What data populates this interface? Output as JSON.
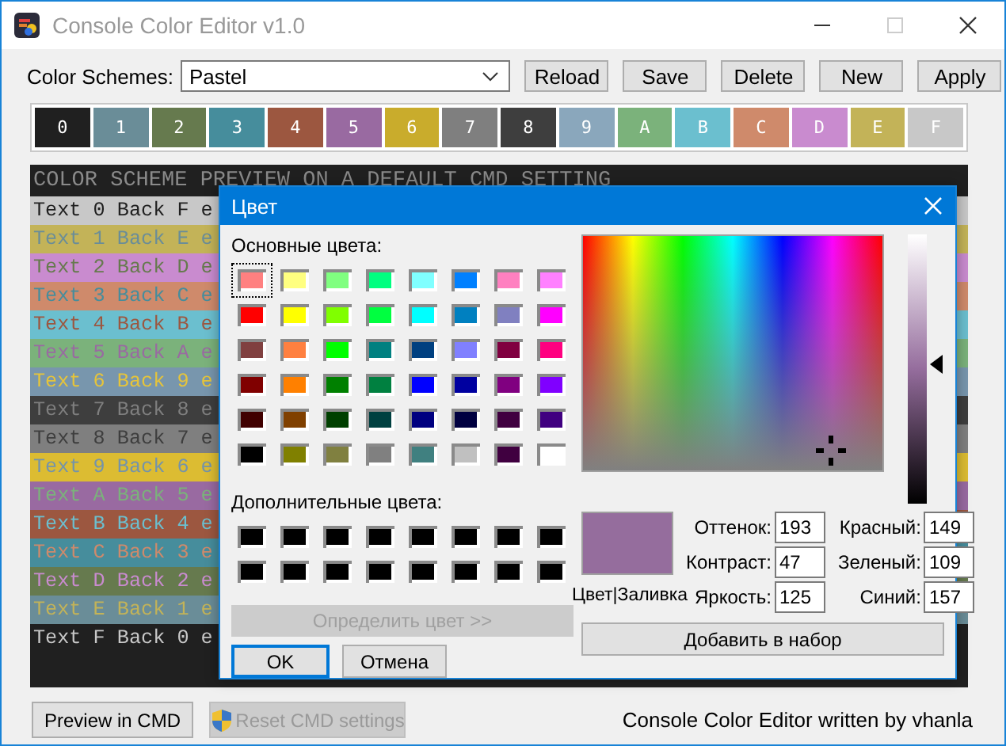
{
  "window": {
    "title": "Console Color Editor v1.0"
  },
  "toolbar": {
    "label": "Color Schemes:",
    "scheme": "Pastel",
    "buttons": [
      "Reload",
      "Save",
      "Delete",
      "New",
      "Apply"
    ]
  },
  "palette": [
    {
      "label": "0",
      "color": "#202020"
    },
    {
      "label": "1",
      "color": "#6a8d98"
    },
    {
      "label": "2",
      "color": "#667a4e"
    },
    {
      "label": "3",
      "color": "#468d9c"
    },
    {
      "label": "4",
      "color": "#9c5740"
    },
    {
      "label": "5",
      "color": "#996aa1"
    },
    {
      "label": "6",
      "color": "#c9ac2c"
    },
    {
      "label": "7",
      "color": "#7f7f7f"
    },
    {
      "label": "8",
      "color": "#3e3e3e"
    },
    {
      "label": "9",
      "color": "#8aa7bc"
    },
    {
      "label": "A",
      "color": "#7bb27b"
    },
    {
      "label": "B",
      "color": "#6bbfcf"
    },
    {
      "label": "C",
      "color": "#cf8a6b"
    },
    {
      "label": "D",
      "color": "#c98bcf"
    },
    {
      "label": "E",
      "color": "#c3b358"
    },
    {
      "label": "F",
      "color": "#c8c8c8"
    }
  ],
  "preview": {
    "header": "COLOR SCHEME PREVIEW ON A DEFAULT CMD SETTING",
    "rows": [
      {
        "color": "#c8c8c8",
        "label": {
          "text": "Text 0 Back F e",
          "color": "#202020"
        }
      },
      {
        "color": "#c3b358",
        "label": {
          "text": "Text 1 Back E e",
          "color": "#6a8d98"
        }
      },
      {
        "color": "#c98bcf",
        "label": {
          "text": "Text 2 Back D e",
          "color": "#667a4e"
        }
      },
      {
        "color": "#cf8a6b",
        "label": {
          "text": "Text 3 Back C e",
          "color": "#468d9c"
        }
      },
      {
        "color": "#6bbfcf",
        "label": {
          "text": "Text 4 Back B e",
          "color": "#9c5740"
        }
      },
      {
        "color": "#7bb27b",
        "label": {
          "text": "Text 5 Back A e",
          "color": "#996aa1"
        }
      },
      {
        "color": "#7896ad",
        "label": {
          "text": "Text 6 Back 9 e",
          "color": "#e6c43a"
        }
      },
      {
        "color": "#3e3e3e",
        "label": {
          "text": "Text 7 Back 8 e",
          "color": "#7f7f7f"
        }
      },
      {
        "color": "#7f7f7f",
        "label": {
          "text": "Text 8 Back 7 e",
          "color": "#3e3e3e"
        }
      },
      {
        "color": "#dcbc32",
        "label": {
          "text": "Text 9 Back 6 e",
          "color": "#7393ab"
        }
      },
      {
        "color": "#996aa1",
        "label": {
          "text": "Text A Back 5 e",
          "color": "#7bb27b"
        }
      },
      {
        "color": "#9c5740",
        "label": {
          "text": "Text B Back 4 e",
          "color": "#6bbfcf"
        }
      },
      {
        "color": "#468d9c",
        "label": {
          "text": "Text C Back 3 e",
          "color": "#cf8a6b"
        }
      },
      {
        "color": "#667a4e",
        "label": {
          "text": "Text D Back 2 e",
          "color": "#c98bcf"
        }
      },
      {
        "color": "#6a8d98",
        "label": {
          "text": "Text E Back 1 e",
          "color": "#c3b358"
        }
      },
      {
        "color": "#202020",
        "label": {
          "text": "Text F Back 0 e",
          "color": "#c8c8c8"
        }
      }
    ]
  },
  "footer": {
    "buttons": [
      {
        "label": "Preview in CMD",
        "disabled": false,
        "kind": "plain"
      },
      {
        "label": "Reset CMD settings",
        "disabled": true,
        "kind": "shield"
      }
    ],
    "credit": "Console Color Editor written by vhanla"
  },
  "dialog": {
    "title": "Цвет",
    "basic_label": "Основные цвета:",
    "basic_colors": [
      {
        "color": "#ff8080",
        "selected": true
      },
      {
        "color": "#ffff80",
        "selected": false
      },
      {
        "color": "#80ff80",
        "selected": false
      },
      {
        "color": "#00ff80",
        "selected": false
      },
      {
        "color": "#80ffff",
        "selected": false
      },
      {
        "color": "#0080ff",
        "selected": false
      },
      {
        "color": "#ff80c0",
        "selected": false
      },
      {
        "color": "#ff80ff",
        "selected": false
      },
      {
        "color": "#ff0000",
        "selected": false
      },
      {
        "color": "#ffff00",
        "selected": false
      },
      {
        "color": "#80ff00",
        "selected": false
      },
      {
        "color": "#00ff40",
        "selected": false
      },
      {
        "color": "#00ffff",
        "selected": false
      },
      {
        "color": "#0080c0",
        "selected": false
      },
      {
        "color": "#8080c0",
        "selected": false
      },
      {
        "color": "#ff00ff",
        "selected": false
      },
      {
        "color": "#804040",
        "selected": false
      },
      {
        "color": "#ff8040",
        "selected": false
      },
      {
        "color": "#00ff00",
        "selected": false
      },
      {
        "color": "#008080",
        "selected": false
      },
      {
        "color": "#004080",
        "selected": false
      },
      {
        "color": "#8080ff",
        "selected": false
      },
      {
        "color": "#800040",
        "selected": false
      },
      {
        "color": "#ff0080",
        "selected": false
      },
      {
        "color": "#800000",
        "selected": false
      },
      {
        "color": "#ff8000",
        "selected": false
      },
      {
        "color": "#008000",
        "selected": false
      },
      {
        "color": "#008040",
        "selected": false
      },
      {
        "color": "#0000ff",
        "selected": false
      },
      {
        "color": "#0000a0",
        "selected": false
      },
      {
        "color": "#800080",
        "selected": false
      },
      {
        "color": "#8000ff",
        "selected": false
      },
      {
        "color": "#400000",
        "selected": false
      },
      {
        "color": "#804000",
        "selected": false
      },
      {
        "color": "#004000",
        "selected": false
      },
      {
        "color": "#004040",
        "selected": false
      },
      {
        "color": "#000080",
        "selected": false
      },
      {
        "color": "#000040",
        "selected": false
      },
      {
        "color": "#400040",
        "selected": false
      },
      {
        "color": "#400080",
        "selected": false
      },
      {
        "color": "#000000",
        "selected": false
      },
      {
        "color": "#808000",
        "selected": false
      },
      {
        "color": "#808040",
        "selected": false
      },
      {
        "color": "#808080",
        "selected": false
      },
      {
        "color": "#408080",
        "selected": false
      },
      {
        "color": "#c0c0c0",
        "selected": false
      },
      {
        "color": "#400040",
        "selected": false
      },
      {
        "color": "#ffffff",
        "selected": false
      }
    ],
    "custom_label": "Дополнительные цвета:",
    "custom_colors": [
      {
        "color": "#000000"
      },
      {
        "color": "#000000"
      },
      {
        "color": "#000000"
      },
      {
        "color": "#000000"
      },
      {
        "color": "#000000"
      },
      {
        "color": "#000000"
      },
      {
        "color": "#000000"
      },
      {
        "color": "#000000"
      },
      {
        "color": "#000000"
      },
      {
        "color": "#000000"
      },
      {
        "color": "#000000"
      },
      {
        "color": "#000000"
      },
      {
        "color": "#000000"
      },
      {
        "color": "#000000"
      },
      {
        "color": "#000000"
      },
      {
        "color": "#000000"
      }
    ],
    "define_button": {
      "label": "Определить цвет >>",
      "disabled": true
    },
    "ok": "OK",
    "cancel": "Отмена",
    "luminance": {
      "level": 0.52
    },
    "color_preview": {
      "color": "#956d9d"
    },
    "preview_label": "Цвет|Заливка",
    "fields": [
      {
        "label": "Оттенок:",
        "value": "193"
      },
      {
        "label": "Красный:",
        "value": "149"
      },
      {
        "label": "Контраст:",
        "value": "47"
      },
      {
        "label": "Зеленый:",
        "value": "109"
      },
      {
        "label": "Яркость:",
        "value": "125"
      },
      {
        "label": "Синий:",
        "value": "157"
      }
    ],
    "add_button": "Добавить в набор"
  }
}
